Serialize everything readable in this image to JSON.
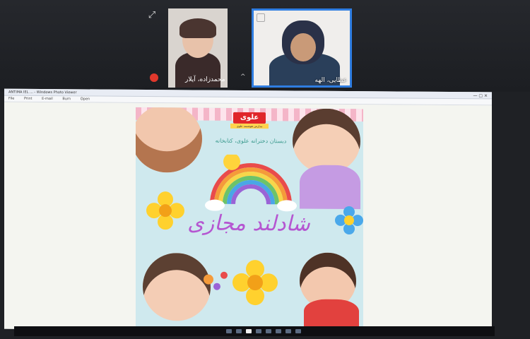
{
  "participants": [
    {
      "name": "محمدزاده، آیلار"
    },
    {
      "name": "عطایی، الهه"
    }
  ],
  "shared_window": {
    "title": "ANTIMA IEL ... - Windows Photo Viewer",
    "menu": [
      "File",
      "Print",
      "E-mail",
      "Burn",
      "Open"
    ],
    "window_controls": "—  ▢  ✕"
  },
  "poster": {
    "brand": "علوی",
    "brand_sub": "مدارس هوشمند علوی",
    "tagline": "دبستان دخترانه علوی، کتابخانه",
    "headline": "شادلند مجازی"
  },
  "colors": {
    "accent": "#2f7de1",
    "brand_red": "#e0252a",
    "headline_purple": "#b556d1"
  }
}
